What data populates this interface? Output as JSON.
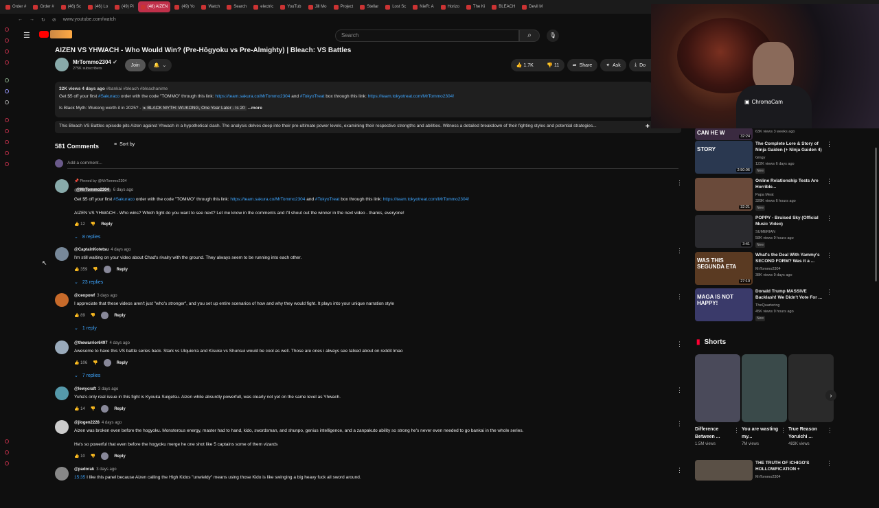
{
  "tabs": [
    {
      "label": "Order #",
      "active": false
    },
    {
      "label": "Order #",
      "active": false
    },
    {
      "label": "(46) Sc",
      "active": false
    },
    {
      "label": "(46) Lo",
      "active": false
    },
    {
      "label": "(49) Pi",
      "active": false
    },
    {
      "label": "(48) AIZEN",
      "active": true
    },
    {
      "label": "(49) Yo",
      "active": false
    },
    {
      "label": "Watch",
      "active": false
    },
    {
      "label": "Search",
      "active": false
    },
    {
      "label": "electric",
      "active": false
    },
    {
      "label": "YouTub",
      "active": false
    },
    {
      "label": "Jill Mo",
      "active": false
    },
    {
      "label": "Project",
      "active": false
    },
    {
      "label": "Stellar",
      "active": false
    },
    {
      "label": "Lost Sc",
      "active": false
    },
    {
      "label": "NieR: A",
      "active": false
    },
    {
      "label": "Horizo",
      "active": false
    },
    {
      "label": "The Ki",
      "active": false
    },
    {
      "label": "BLEACH",
      "active": false
    },
    {
      "label": "Devil M",
      "active": false
    }
  ],
  "url": "www.youtube.com/watch",
  "search": {
    "placeholder": "Search"
  },
  "video": {
    "title": "AIZEN VS YHWACH - Who Would Win? (Pre-Hōgyoku vs Pre-Almighty) | Bleach: VS Battles",
    "channel": "MrTommo2304",
    "subscribers": "275K subscribers",
    "join": "Join",
    "likes": "1.7K",
    "dislikes": "11",
    "share": "Share",
    "ask": "Ask",
    "download": "Do"
  },
  "description": {
    "meta": "32K views  4 days ago",
    "tags": "#bankai #bleach #bleachanime",
    "line1_a": "Get $5 off your first",
    "line1_b": "#Sakuraco",
    "line1_c": "order with the code \"TOMMO\" through this link:",
    "line1_link": "https://team.sakura.co/MrTommo2304",
    "line1_d": "and",
    "line1_e": "#TokyoTreat",
    "line1_f": "box through this link:",
    "line1_link2": "https://team.tokyotreat.com/MrTommo2304!",
    "line2": "Is Black Myth: Wukong worth it in 2025? -",
    "line2_b": "▸ BLACK MYTH: WUKONG, One Year Later - Is 20",
    "more": "...more"
  },
  "summary": "This Bleach VS Battles episode pits Aizen against Yhwach in a hypothetical clash. The analysis delves deep into their pre-ultimate power levels, examining their respective strengths and abilities. Witness a detailed breakdown of their fighting styles and potential strategies...",
  "comments_header": {
    "count": "581 Comments",
    "sort": "Sort by",
    "add": "Add a comment..."
  },
  "pinned": {
    "pinned_by": "Pinned by @MrTommo2304",
    "handle": "@MrTommo2304",
    "time": "6 days ago",
    "text_a": "Get $5 off your first",
    "tag1": "#Sakuraco",
    "text_b": "order with the code \"TOMMO\" through this link:",
    "link1": "https://team.sakura.co/MrTommo2304",
    "text_c": "and",
    "tag2": "#TokyoTreat",
    "text_d": "box through this link:",
    "link2": "https://team.tokyotreat.com/MrTommo2304!",
    "text2": "AIZEN VS YHWACH - Who wins? Which fight do you want to see next? Let me know in the comments and I'll shout out the winner in the next video - thanks, everyone!",
    "likes": "12",
    "reply": "Reply",
    "replies": "8 replies"
  },
  "comments": [
    {
      "handle": "@CaptainKotetsu",
      "time": "4 days ago",
      "text": "I'm still waiting on your video about Chad's rivalry with the ground. They always seem to be running into each other.",
      "likes": "359",
      "reply": "Reply",
      "replies": "23 replies"
    },
    {
      "handle": "@ceopowf",
      "time": "3 days ago",
      "text": "I appreciate that these videos aren't just \"who's stronger\", and you set up entire scenarios of how and why they would fight. It plays into your unique narration style",
      "likes": "89",
      "reply": "Reply",
      "replies": "1 reply"
    },
    {
      "handle": "@thewarrior6497",
      "time": "4 days ago",
      "text": "Awesome to have this VS battle series back. Stark vs Ulquiorra and Kisuke vs Shunsui would be cool as well. Those are ones i always see talked about on reddit lmao",
      "likes": "106",
      "reply": "Reply",
      "replies": "7 replies"
    },
    {
      "handle": "@lewycraft",
      "time": "3 days ago",
      "text": "Yuha's only real issue in this fight is Kyouka Suigetsu. Aizen while absurdly powerfull, was clearly not yet on the same level as Yhwach.",
      "likes": "14",
      "reply": "Reply",
      "replies": ""
    },
    {
      "handle": "@jlogen2228",
      "time": "4 days ago",
      "text": "Aizen was broken even before the hogyoku. Monsterous energy, master had to hand, kido, swordsman, and shunpo, genius intelligence, and a zanpakuto ability so strong he's never even needed to go bankai in the whole series.",
      "text2": "He's so powerful that even before the hogyoku merge he one shot like 5 captains some of them vizards",
      "likes": "10",
      "reply": "Reply",
      "replies": ""
    },
    {
      "handle": "@padorak",
      "time": "3 days ago",
      "text": "I like this panel because Aizen calling the High Kidos \"unwieldy\" means using those Kido is like swinging a big heavy fuck all sword around.",
      "timestamp": "15:35",
      "likes": "",
      "reply": "",
      "replies": ""
    }
  ],
  "recommended": [
    {
      "title": "",
      "meta1": "63K views  3 weeks ago",
      "duration": "32:24",
      "thumb_text": "CAN HE W",
      "color": "#3a2a40"
    },
    {
      "title": "The Complete Lore & Story of Ninja Gaiden (+ Ninja Gaiden 4)",
      "channel": "Gingy",
      "meta1": "122K views  6 days ago",
      "duration": "2:50:06",
      "thumb_text": "STORY",
      "color": "#2a3850",
      "new": "New"
    },
    {
      "title": "Online Relationship Tests Are Horrible...",
      "channel": "Papa Meat",
      "meta1": "328K views  6 hours ago",
      "duration": "32:21",
      "thumb_text": "",
      "color": "#6a4a3a",
      "new": "New"
    },
    {
      "title": "POPPY - Bruised Sky (Official Music Video)",
      "channel": "SUMERIAN",
      "meta1": "58K views  9 hours ago",
      "duration": "3:41",
      "thumb_text": "",
      "color": "#2a2a2e",
      "new": "New"
    },
    {
      "title": "What's the Deal With Yammy's SECOND FORM? Was it a ...",
      "channel": "MrTommo2304",
      "meta1": "38K views  9 days ago",
      "duration": "27:10",
      "thumb_text": "WAS THIS SEGUNDA ETA",
      "color": "#5a3a22"
    },
    {
      "title": "Donald Trump MASSIVE Backlash! We Didn't Vote For ...",
      "channel": "TheQuartering",
      "meta1": "45K views  9 hours ago",
      "duration": "",
      "thumb_text": "MAGA IS NOT HAPPY!",
      "color": "#3a3a6a",
      "new": "New"
    }
  ],
  "shorts": {
    "heading": "Shorts",
    "items": [
      {
        "title": "Difference Between ...",
        "views": "1.5M views",
        "color": "#4a4a5a"
      },
      {
        "title": "You are wasting my...",
        "views": "7M views",
        "color": "#3a4a4a"
      },
      {
        "title": "True Reason Yoruichi ...",
        "views": "483K views",
        "color": "#2a2a2a"
      }
    ]
  },
  "bottom_rec": {
    "title": "THE TRUTH OF ICHIGO'S HOLLOWFICATION +",
    "channel": "MrTommo2304"
  },
  "cam": {
    "label": "ChromaCam"
  }
}
